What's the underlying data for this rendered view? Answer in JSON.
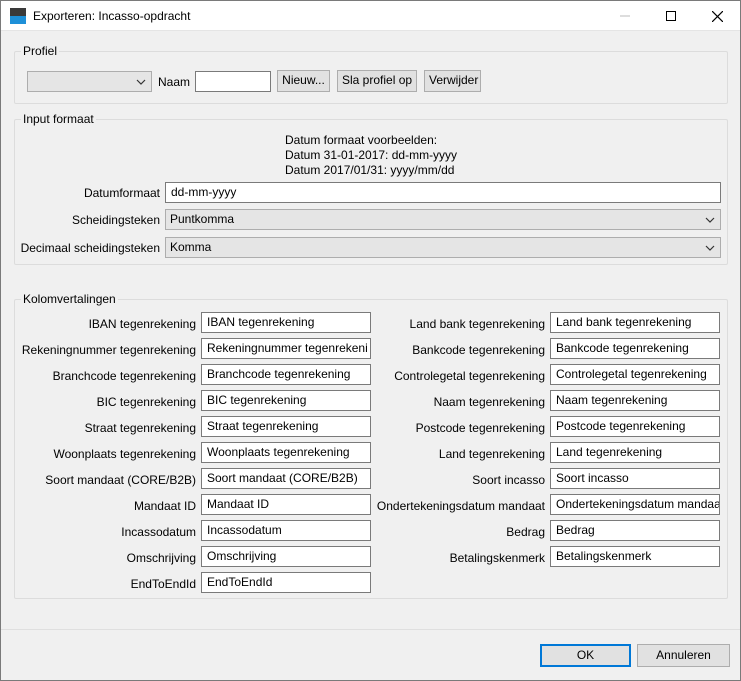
{
  "window": {
    "title": "Exporteren: Incasso-opdracht"
  },
  "profiel": {
    "group_title": "Profiel",
    "profile_select_value": "",
    "naam_label": "Naam",
    "naam_value": "",
    "nieuw_button": "Nieuw...",
    "sla_op_button": "Sla profiel op",
    "verwijder_button": "Verwijder"
  },
  "input_formaat": {
    "group_title": "Input formaat",
    "examples_line1": "Datum formaat voorbeelden:",
    "examples_line2": "Datum 31-01-2017: dd-mm-yyyy",
    "examples_line3": "Datum 2017/01/31: yyyy/mm/dd",
    "datumformaat_label": "Datumformaat",
    "datumformaat_value": "dd-mm-yyyy",
    "scheidingsteken_label": "Scheidingsteken",
    "scheidingsteken_value": "Puntkomma",
    "decimaal_label": "Decimaal scheidingsteken",
    "decimaal_value": "Komma"
  },
  "kolomvertalingen": {
    "group_title": "Kolomvertalingen",
    "left": [
      {
        "label": "IBAN tegenrekening",
        "value": "IBAN tegenrekening"
      },
      {
        "label": "Rekeningnummer tegenrekening",
        "value": "Rekeningnummer tegenrekeni"
      },
      {
        "label": "Branchcode tegenrekening",
        "value": "Branchcode tegenrekening"
      },
      {
        "label": "BIC tegenrekening",
        "value": "BIC tegenrekening"
      },
      {
        "label": "Straat tegenrekening",
        "value": "Straat tegenrekening"
      },
      {
        "label": "Woonplaats tegenrekening",
        "value": "Woonplaats tegenrekening"
      },
      {
        "label": "Soort mandaat (CORE/B2B)",
        "value": "Soort mandaat (CORE/B2B)"
      },
      {
        "label": "Mandaat ID",
        "value": "Mandaat ID"
      },
      {
        "label": "Incassodatum",
        "value": "Incassodatum"
      },
      {
        "label": "Omschrijving",
        "value": "Omschrijving"
      },
      {
        "label": "EndToEndId",
        "value": "EndToEndId"
      }
    ],
    "right": [
      {
        "label": "Land bank tegenrekening",
        "value": "Land bank tegenrekening"
      },
      {
        "label": "Bankcode tegenrekening",
        "value": "Bankcode tegenrekening"
      },
      {
        "label": "Controlegetal tegenrekening",
        "value": "Controlegetal tegenrekening"
      },
      {
        "label": "Naam tegenrekening",
        "value": "Naam tegenrekening"
      },
      {
        "label": "Postcode tegenrekening",
        "value": "Postcode tegenrekening"
      },
      {
        "label": "Land tegenrekening",
        "value": "Land tegenrekening"
      },
      {
        "label": "Soort incasso",
        "value": "Soort incasso"
      },
      {
        "label": "Ondertekeningsdatum mandaat",
        "value": "Ondertekeningsdatum mandaa"
      },
      {
        "label": "Bedrag",
        "value": "Bedrag"
      },
      {
        "label": "Betalingskenmerk",
        "value": "Betalingskenmerk"
      }
    ]
  },
  "footer": {
    "ok_button": "OK",
    "annuleren_button": "Annuleren"
  },
  "colors": {
    "accent": "#0078d7",
    "window_bg": "#f0f0f0",
    "field_border": "#7a7a7a"
  }
}
